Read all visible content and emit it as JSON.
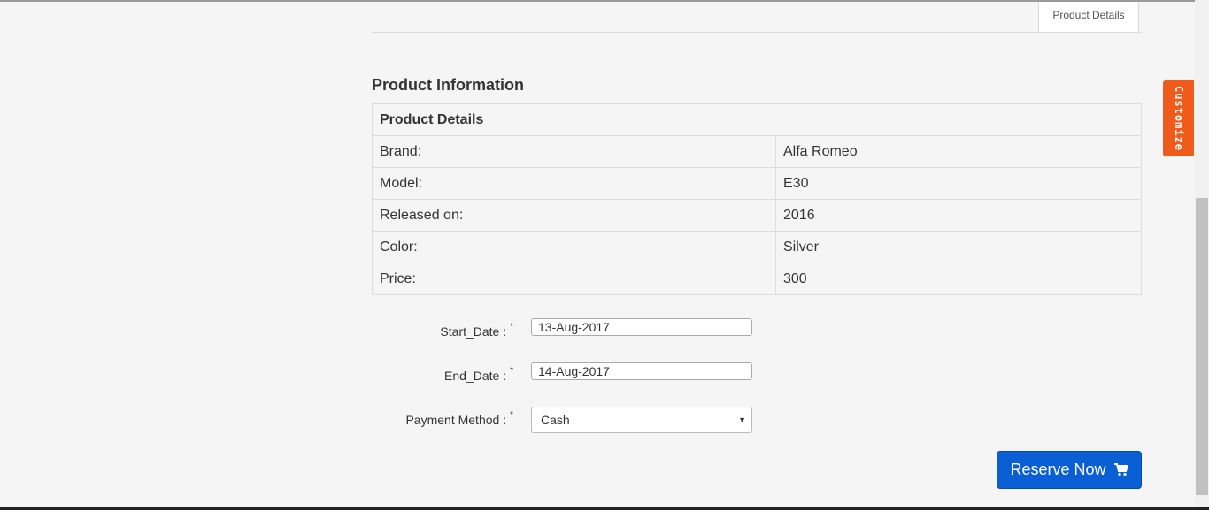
{
  "tabs": {
    "active_label": "Product Details"
  },
  "section": {
    "title": "Product Information"
  },
  "details_table": {
    "header": "Product Details",
    "rows": [
      {
        "key": "Brand:",
        "value": "Alfa Romeo"
      },
      {
        "key": "Model:",
        "value": "E30"
      },
      {
        "key": "Released on:",
        "value": "2016"
      },
      {
        "key": "Color:",
        "value": "Silver"
      },
      {
        "key": "Price:",
        "value": "300"
      }
    ]
  },
  "form": {
    "start_date": {
      "label": "Start_Date :",
      "required_mark": "*",
      "value": "13-Aug-2017"
    },
    "end_date": {
      "label": "End_Date :",
      "required_mark": "*",
      "value": "14-Aug-2017"
    },
    "payment_method": {
      "label": "Payment Method :",
      "required_mark": "*",
      "selected": "Cash"
    }
  },
  "actions": {
    "reserve_label": "Reserve Now",
    "reserve_icon": "cart-icon",
    "reserve_color": "#0a5fd5"
  },
  "side_tab": {
    "label": "Customize",
    "color": "#f05a1a"
  }
}
